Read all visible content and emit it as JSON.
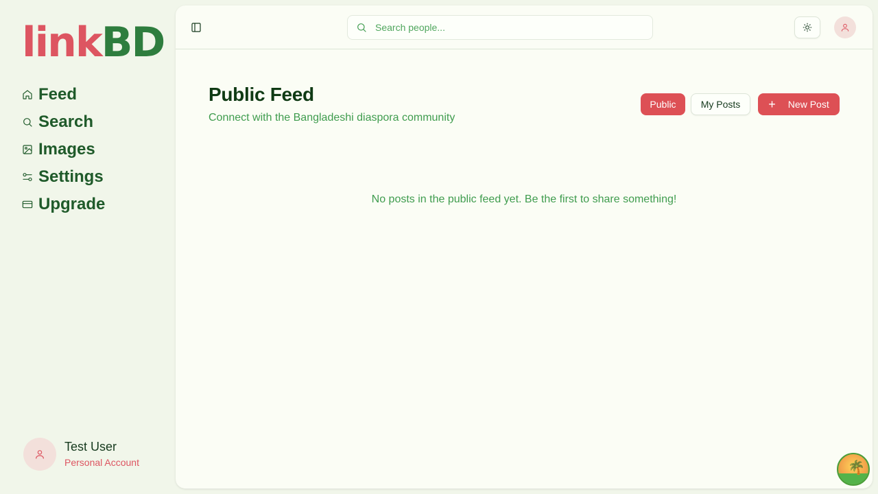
{
  "brand": {
    "part_a": "link",
    "part_b": "BD"
  },
  "sidebar": {
    "items": [
      {
        "label": "Feed",
        "icon": "home-icon"
      },
      {
        "label": "Search",
        "icon": "search-icon"
      },
      {
        "label": "Images",
        "icon": "image-icon"
      },
      {
        "label": "Settings",
        "icon": "sliders-icon"
      },
      {
        "label": "Upgrade",
        "icon": "credit-card-icon"
      }
    ],
    "user": {
      "name": "Test User",
      "account_type": "Personal Account"
    }
  },
  "topbar": {
    "search_placeholder": "Search people..."
  },
  "main": {
    "title": "Public Feed",
    "subtitle": "Connect with the Bangladeshi diaspora community",
    "buttons": {
      "public": "Public",
      "my_posts": "My Posts",
      "new_post": "New Post"
    },
    "empty_message": "No posts in the public feed yet. Be the first to share something!"
  },
  "colors": {
    "accent_red": "#dd5055",
    "brand_green": "#2e7d3e",
    "text_green": "#3f9c4e",
    "background": "#f1f6ea"
  }
}
